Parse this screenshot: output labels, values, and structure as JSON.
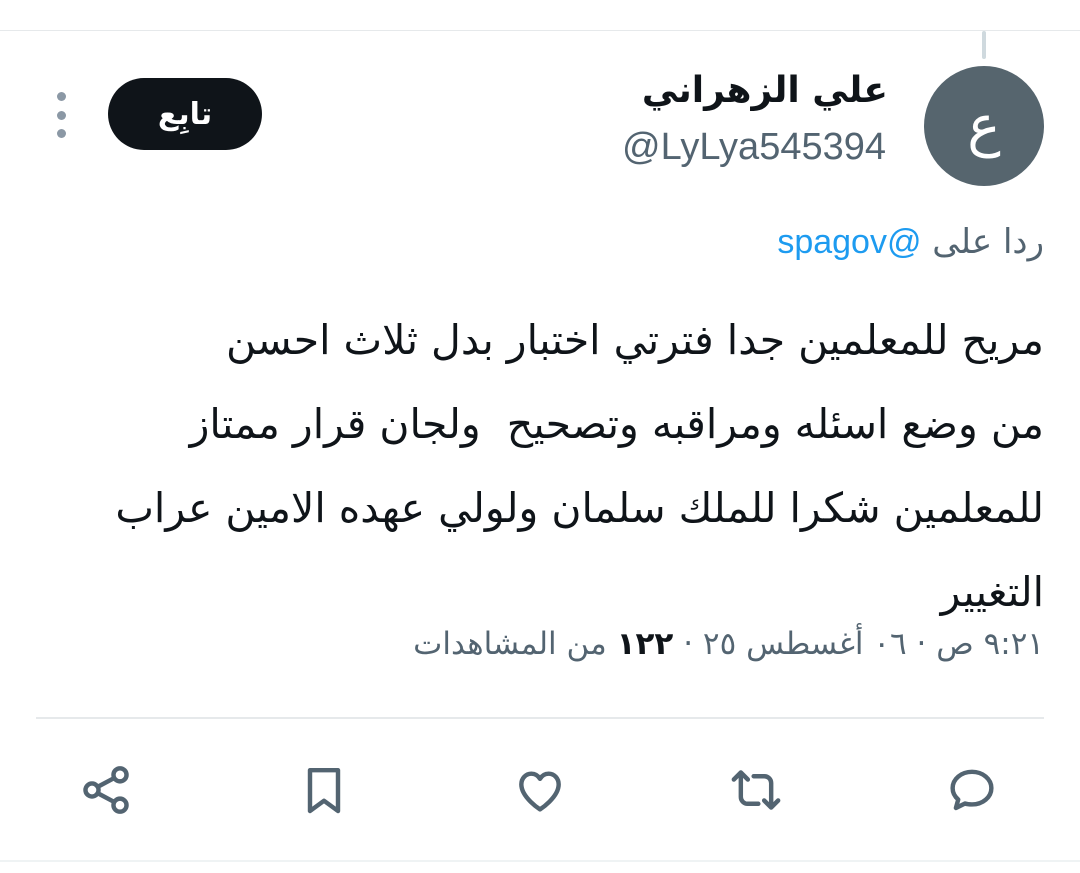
{
  "tweet": {
    "avatar_letter": "ع",
    "display_name": "علي الزهراني",
    "handle": "@LyLya545394",
    "follow_label": "تابِع",
    "reply_to_prefix": "ردا على",
    "reply_to_mention": "@spagov",
    "text": "مريح للمعلمين جدا فترتي اختبار بدل ثلاث احسن\nمن وضع اسئله ومراقبه وتصحيح  ولجان قرار ممتاز\nللمعلمين شكرا للملك سلمان ولولي عهده الامين عراب\nالتغيير",
    "timestamp": "٩:٢١ ص · ٠٦ أغسطس ٢٥ · ",
    "views_count": "١٢٢",
    "views_label": " من المشاهدات"
  },
  "colors": {
    "avatar_bg": "#56656e",
    "follow_bg": "#0f1419",
    "mention": "#1d9bf0",
    "secondary_text": "#536471",
    "icon": "#536471"
  },
  "actions": {
    "icons": [
      "reply-icon",
      "retweet-icon",
      "like-icon",
      "bookmark-icon",
      "share-icon"
    ]
  }
}
